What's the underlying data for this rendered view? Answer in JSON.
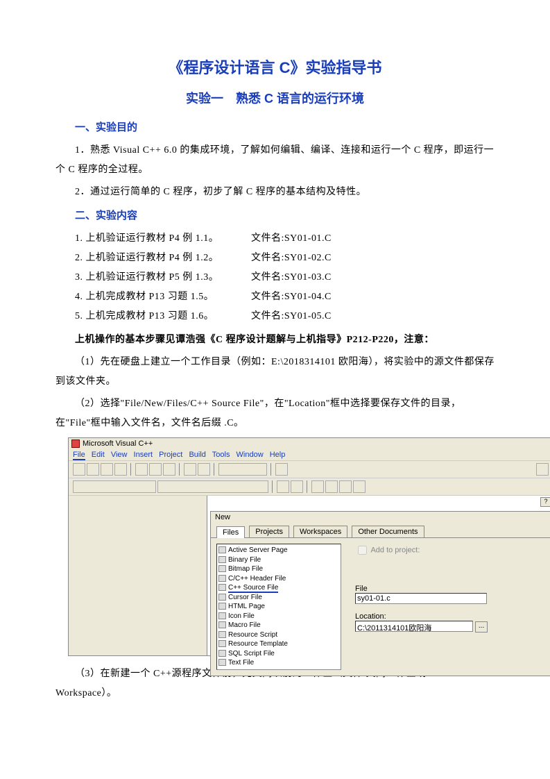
{
  "doc": {
    "title": "《程序设计语言 C》实验指导书",
    "subtitle": "实验一　熟悉 C 语言的运行环境",
    "section1_heading": "一、实验目的",
    "s1_p1": "1．熟悉 Visual C++ 6.0 的集成环境，了解如何编辑、编译、连接和运行一个 C 程序，即运行一个 C 程序的全过程。",
    "s1_p2": "2．通过运行简单的 C 程序，初步了解 C 程序的基本结构及特性。",
    "section2_heading": "二、实验内容",
    "items": [
      {
        "desc": "1. 上机验证运行教材 P4 例 1.1。",
        "fname": "文件名:SY01-01.C"
      },
      {
        "desc": "2. 上机验证运行教材 P4 例 1.2。",
        "fname": "文件名:SY01-02.C"
      },
      {
        "desc": "3. 上机验证运行教材 P5 例 1.3。",
        "fname": "文件名:SY01-03.C"
      },
      {
        "desc": "4. 上机完成教材 P13 习题 1.5。",
        "fname": "文件名:SY01-04.C"
      },
      {
        "desc": "5. 上机完成教材 P13 习题 1.6。",
        "fname": "文件名:SY01-05.C"
      }
    ],
    "note_bold": "上机操作的基本步骤见谭浩强《C 程序设计题解与上机指导》P212-P220，注意：",
    "p_step1": "（1）先在硬盘上建立一个工作目录（例如：E:\\2018314101 欧阳海），将实验中的源文件都保存到该文件夹。",
    "p_step2": "（2）选择\"File/New/Files/C++ Source File\"，在\"Location\"框中选择要保存文件的目录，在\"File\"框中输入文件名，文件名后缀 .C。",
    "p_step3": "（3）在新建一个 C++源程序文件前，先关闭以前的工作区（文件/关闭工作区或 File/Close Workspace）。"
  },
  "ide": {
    "app_title": "Microsoft Visual C++",
    "menu": [
      "File",
      "Edit",
      "View",
      "Insert",
      "Project",
      "Build",
      "Tools",
      "Window",
      "Help"
    ],
    "dialog_title": "New",
    "tabs": [
      "Files",
      "Projects",
      "Workspaces",
      "Other Documents"
    ],
    "filetypes": [
      "Active Server Page",
      "Binary File",
      "Bitmap File",
      "C/C++ Header File",
      "C++ Source File",
      "Cursor File",
      "HTML Page",
      "Icon File",
      "Macro File",
      "Resource Script",
      "Resource Template",
      "SQL Script File",
      "Text File"
    ],
    "add_to_project": "Add to project:",
    "file_label": "File",
    "file_value": "sy01-01.c",
    "location_label": "Location:",
    "location_value": "C:\\2011314101欧阳海",
    "browse": "..."
  }
}
